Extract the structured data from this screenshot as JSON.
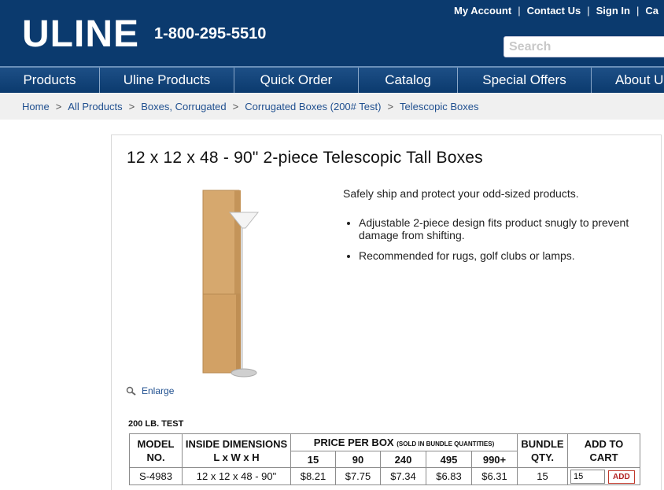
{
  "header": {
    "logo": "ULINE",
    "phone": "1-800-295-5510",
    "links": [
      "My Account",
      "Contact Us",
      "Sign In",
      "Ca"
    ],
    "search_placeholder": "Search",
    "bg_color": "#0b3a6e"
  },
  "nav": {
    "items": [
      "Products",
      "Uline Products",
      "Quick Order",
      "Catalog",
      "Special Offers",
      "About U"
    ]
  },
  "breadcrumb": [
    "Home",
    "All Products",
    "Boxes, Corrugated",
    "Corrugated Boxes (200# Test)",
    "Telescopic Boxes"
  ],
  "product": {
    "title": "12 x 12 x 48 - 90\" 2-piece Telescopic Tall Boxes",
    "intro": "Safely ship and protect your odd-sized products.",
    "bullets": [
      "Adjustable 2-piece design fits product snugly to prevent damage from shifting.",
      "Recommended for rugs, golf clubs or lamps."
    ],
    "enlarge_label": "Enlarge",
    "test_label": "200 LB. TEST"
  },
  "table": {
    "headers": {
      "model": "MODEL NO.",
      "dims_top": "INSIDE DIMENSIONS",
      "dims_bottom": "L x W x H",
      "price": "PRICE PER BOX",
      "price_note": "(SOLD IN BUNDLE QUANTITIES)",
      "bundle": "BUNDLE QTY.",
      "add": "ADD TO CART"
    },
    "tiers": [
      "15",
      "90",
      "240",
      "495",
      "990+"
    ],
    "row": {
      "model": "S-4983",
      "dims": "12 x 12 x 48 - 90\"",
      "prices": [
        "$8.21",
        "$7.75",
        "$7.34",
        "$6.83",
        "$6.31"
      ],
      "bundle": "15",
      "qty_value": "15",
      "add_label": "ADD"
    }
  }
}
